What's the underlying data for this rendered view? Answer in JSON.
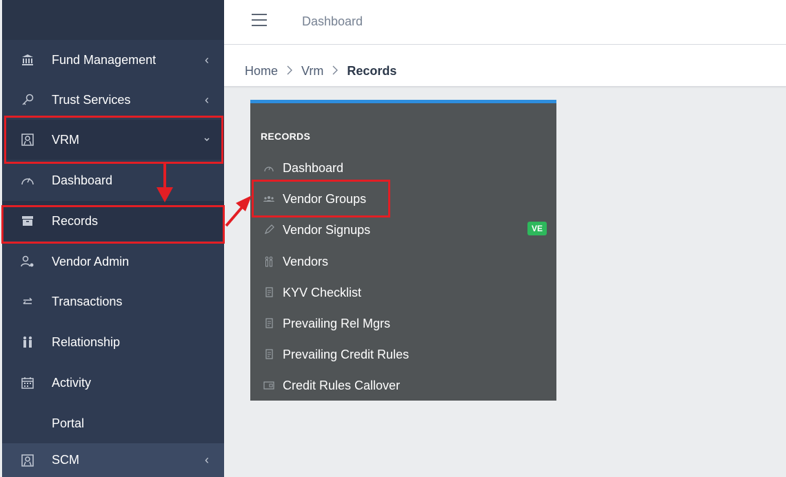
{
  "sidebar": {
    "items": [
      {
        "label": "Fund Management",
        "icon": "bank-icon"
      },
      {
        "label": "Trust Services",
        "icon": "key-icon"
      },
      {
        "label": "VRM",
        "icon": "vrm-icon"
      },
      {
        "label": "Dashboard",
        "icon": "speedometer-icon"
      },
      {
        "label": "Records",
        "icon": "archive-icon"
      },
      {
        "label": "Vendor Admin",
        "icon": "user-settings-icon"
      },
      {
        "label": "Transactions",
        "icon": "swap-icon"
      },
      {
        "label": "Relationship",
        "icon": "people-icon"
      },
      {
        "label": "Activity",
        "icon": "calendar-icon"
      },
      {
        "label": "Portal",
        "icon": ""
      },
      {
        "label": "SCM",
        "icon": "scm-icon"
      }
    ]
  },
  "header": {
    "title": "Dashboard"
  },
  "breadcrumb": {
    "home": "Home",
    "section": "Vrm",
    "current": "Records"
  },
  "records_menu": {
    "heading": "RECORDS",
    "items": [
      {
        "label": "Dashboard",
        "icon": "speedometer-icon"
      },
      {
        "label": "Vendor Groups",
        "icon": "group-icon"
      },
      {
        "label": "Vendor Signups",
        "icon": "pencil-icon",
        "badge": "VE"
      },
      {
        "label": "Vendors",
        "icon": "people-icon"
      },
      {
        "label": "KYV Checklist",
        "icon": "document-icon"
      },
      {
        "label": "Prevailing Rel Mgrs",
        "icon": "document-icon"
      },
      {
        "label": "Prevailing Credit Rules",
        "icon": "document-icon"
      },
      {
        "label": "Credit Rules Callover",
        "icon": "card-icon"
      }
    ]
  },
  "colors": {
    "sidebar": "#2f3b52",
    "panel": "#505456",
    "accent": "#2e8ede",
    "badge": "#2eb85c",
    "annotation": "#e31e24"
  }
}
